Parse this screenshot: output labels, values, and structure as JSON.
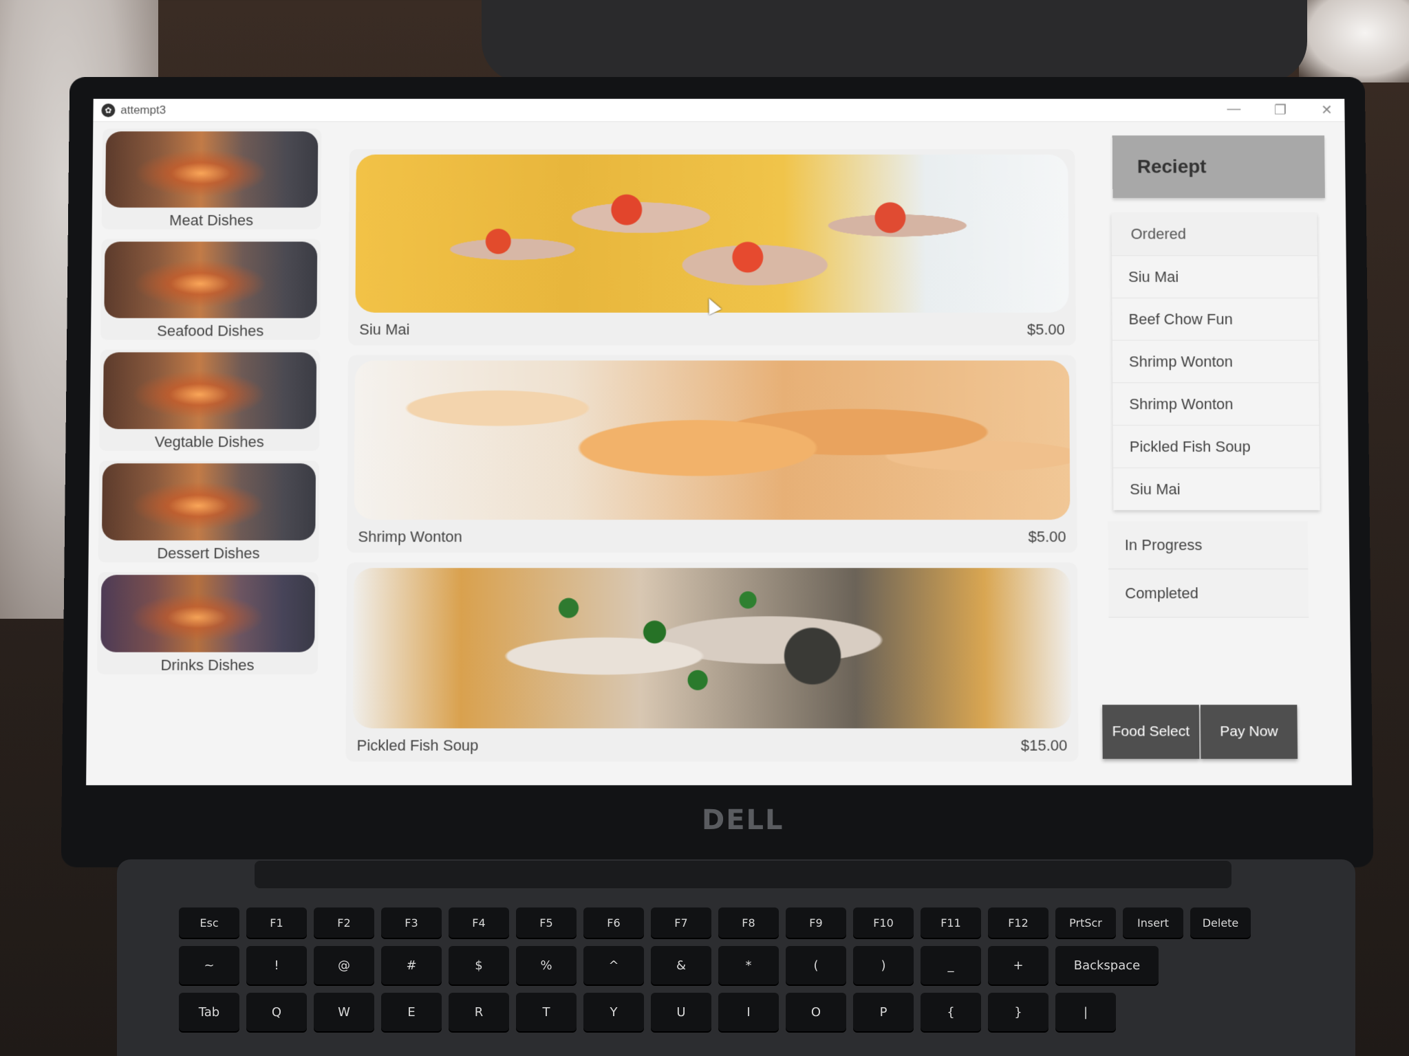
{
  "window": {
    "title": "attempt3",
    "controls": {
      "minimize": "—",
      "restore": "❐",
      "close": "✕"
    }
  },
  "categories": [
    {
      "label": "Meat Dishes"
    },
    {
      "label": "Seafood Dishes"
    },
    {
      "label": "Vegtable Dishes"
    },
    {
      "label": "Dessert Dishes"
    },
    {
      "label": "Drinks Dishes"
    }
  ],
  "dishes": [
    {
      "name": "Siu Mai",
      "price": "$5.00"
    },
    {
      "name": "Shrimp Wonton",
      "price": "$5.00"
    },
    {
      "name": "Pickled Fish Soup",
      "price": "$15.00"
    }
  ],
  "receipt": {
    "title": "Reciept",
    "ordered_label": "Ordered",
    "ordered_items": [
      "Siu Mai",
      "Beef Chow Fun",
      "Shrimp Wonton",
      "Shrimp Wonton",
      "Pickled Fish Soup",
      "Siu Mai"
    ],
    "in_progress_label": "In Progress",
    "completed_label": "Completed"
  },
  "actions": {
    "food_select": "Food Select",
    "pay_now": "Pay Now"
  },
  "laptop": {
    "brand": "DELL",
    "fn_row": [
      "Esc",
      "F1",
      "F2",
      "F3",
      "F4",
      "F5",
      "F6",
      "F7",
      "F8",
      "F9",
      "F10",
      "F11",
      "F12",
      "PrtScr",
      "Insert",
      "Delete"
    ],
    "num_row": [
      "~",
      "!",
      "@",
      "#",
      "$",
      "%",
      "^",
      "&",
      "*",
      "(",
      ")",
      "_",
      "+",
      "Backspace"
    ],
    "top_row": [
      "Tab",
      "Q",
      "W",
      "E",
      "R",
      "T",
      "Y",
      "U",
      "I",
      "O",
      "P",
      "{",
      "}",
      "|"
    ]
  }
}
